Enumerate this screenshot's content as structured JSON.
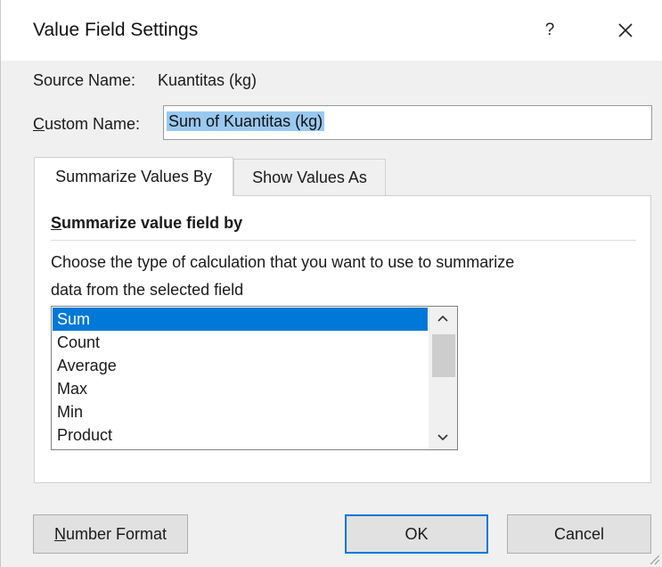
{
  "dialog": {
    "title": "Value Field Settings",
    "help_label": "?",
    "close_icon": "close-icon"
  },
  "source": {
    "label": "Source Name:",
    "value": "Kuantitas (kg)"
  },
  "custom_name": {
    "label_first": "C",
    "label_rest": "ustom Name:",
    "value": "Sum of Kuantitas (kg)"
  },
  "tabs": [
    {
      "label": "Summarize Values By",
      "active": true
    },
    {
      "label": "Show Values As",
      "active": false
    }
  ],
  "panel": {
    "heading_first": "S",
    "heading_rest": "ummarize value field by",
    "description_line1": "Choose the type of calculation that you want to use to summarize",
    "description_line2": "data from the selected field",
    "options": [
      "Sum",
      "Count",
      "Average",
      "Max",
      "Min",
      "Product"
    ],
    "selected": "Sum"
  },
  "buttons": {
    "number_format_first": "N",
    "number_format_rest": "umber Format",
    "ok": "OK",
    "cancel": "Cancel"
  },
  "colors": {
    "selection": "#0078d7",
    "text_highlight": "#99c9ef"
  }
}
